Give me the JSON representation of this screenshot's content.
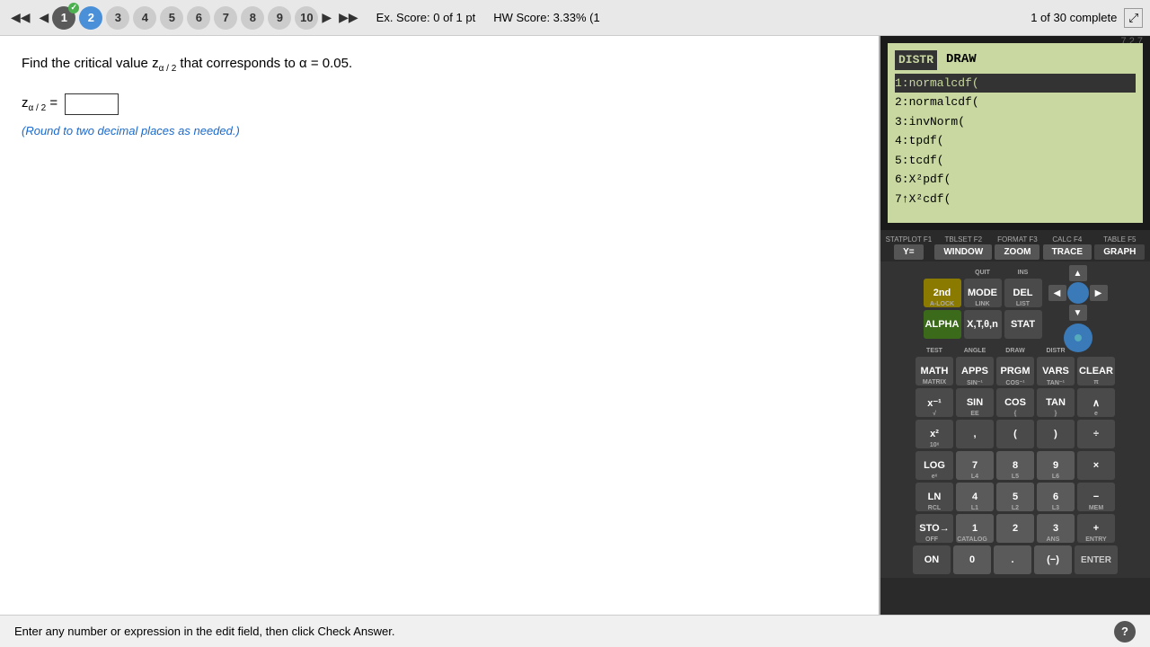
{
  "version": "7.2.7",
  "nav": {
    "prev_label": "◀◀",
    "prev_single": "◀",
    "next_single": "▶",
    "next_last": "▶▶",
    "items": [
      {
        "num": "1",
        "state": "completed"
      },
      {
        "num": "2",
        "state": "active"
      },
      {
        "num": "3",
        "state": "inactive"
      },
      {
        "num": "4",
        "state": "inactive"
      },
      {
        "num": "5",
        "state": "inactive"
      },
      {
        "num": "6",
        "state": "inactive"
      },
      {
        "num": "7",
        "state": "inactive"
      },
      {
        "num": "8",
        "state": "inactive"
      },
      {
        "num": "9",
        "state": "inactive"
      },
      {
        "num": "10",
        "state": "inactive"
      }
    ],
    "ex_score": "Ex. Score: 0 of 1 pt",
    "hw_score": "HW Score: 3.33% (1",
    "complete": "1 of 30 complete"
  },
  "question": {
    "text_part1": "Find the critical value z",
    "subscript": "α / 2",
    "text_part2": " that corresponds to α = 0.05.",
    "answer_label": "z",
    "answer_subscript": "α / 2",
    "answer_equals": " = ",
    "hint": "(Round to two decimal places as needed.)"
  },
  "calculator": {
    "screen": {
      "header_distr": "DISTR",
      "header_draw": "DRAW",
      "items": [
        {
          "num": "1",
          "text": "normalcdf(",
          "selected": true
        },
        {
          "num": "2",
          "text": "normalcdf("
        },
        {
          "num": "3",
          "text": "invNorm("
        },
        {
          "num": "4",
          "text": "tpdf("
        },
        {
          "num": "5",
          "text": "tcdf("
        },
        {
          "num": "6",
          "text": "X²pdf("
        },
        {
          "num": "7",
          "text": "↑X²cdf("
        }
      ]
    },
    "func_row": [
      {
        "top": "STATPLOT F1",
        "label": "Y="
      },
      {
        "top": "TBLSET F2",
        "label": "WINDOW"
      },
      {
        "top": "FORMAT F3",
        "label": "ZOOM"
      },
      {
        "top": "CALC F4",
        "label": "TRACE"
      },
      {
        "top": "TABLE F5",
        "label": "GRAPH"
      }
    ],
    "keys": {
      "row1": [
        {
          "label": "2nd",
          "class": "key-2nd",
          "top": ""
        },
        {
          "label": "MODE",
          "class": "key-mode",
          "top": "QUIT"
        },
        {
          "label": "DEL",
          "class": "key-del",
          "top": "INS"
        }
      ],
      "row2": [
        {
          "label": "ALPHA",
          "class": "key-alpha",
          "top": "A-LOCK"
        },
        {
          "label": "X,T,θ,n",
          "class": "key-xtoon",
          "top": "LINK"
        },
        {
          "label": "STAT",
          "class": "key-stat",
          "top": "LIST"
        }
      ],
      "row3": [
        {
          "label": "MATH",
          "class": "key-math",
          "top": "TEST"
        },
        {
          "label": "APPS",
          "class": "key-apps",
          "top": "ANGLE"
        },
        {
          "label": "PRGM",
          "class": "key-prgm",
          "top": "DRAW"
        },
        {
          "label": "VARS",
          "class": "key-vars",
          "top": "DISTR"
        },
        {
          "label": "CLEAR",
          "class": "key-clear",
          "top": ""
        }
      ],
      "row4": [
        {
          "label": "x⁻¹",
          "class": "key-xinv",
          "top": "MATRIX"
        },
        {
          "label": "SIN",
          "class": "key-sin",
          "top": "SIN⁻¹"
        },
        {
          "label": "COS",
          "class": "key-cos",
          "top": "COS⁻¹"
        },
        {
          "label": "TAN",
          "class": "key-tan",
          "top": "TAN⁻¹"
        },
        {
          "label": "∧",
          "class": "key-caret",
          "top": "π"
        }
      ],
      "row5": [
        {
          "label": "x²",
          "class": "key-x2",
          "top": "√"
        },
        {
          "label": ",",
          "class": "key-comma",
          "top": "EE"
        },
        {
          "label": "(",
          "class": "key-lparen",
          "top": "{"
        },
        {
          "label": ")",
          "class": "key-rparen",
          "top": "}"
        },
        {
          "label": "÷",
          "class": "key-div",
          "top": "e"
        }
      ],
      "row6": [
        {
          "label": "LOG",
          "class": "key-log",
          "top": "10ˣ"
        },
        {
          "label": "7",
          "class": "key-7",
          "top": ""
        },
        {
          "label": "8",
          "class": "key-8",
          "top": ""
        },
        {
          "label": "9",
          "class": "key-9",
          "top": ""
        },
        {
          "label": "×",
          "class": "key-mul",
          "top": ""
        }
      ],
      "row7": [
        {
          "label": "LN",
          "class": "key-ln",
          "top": "eˣ"
        },
        {
          "label": "4",
          "class": "key-4",
          "top": "L4"
        },
        {
          "label": "5",
          "class": "key-5",
          "top": "L5"
        },
        {
          "label": "6",
          "class": "key-6",
          "top": "L6"
        },
        {
          "label": "−",
          "class": "key-minus",
          "top": ""
        }
      ],
      "row8": [
        {
          "label": "STO→",
          "class": "key-sto",
          "top": "RCL"
        },
        {
          "label": "1",
          "class": "key-1",
          "top": "L1"
        },
        {
          "label": "2",
          "class": "key-2",
          "top": "L2"
        },
        {
          "label": "3",
          "class": "key-3",
          "top": "L3"
        },
        {
          "label": "+",
          "class": "key-plus",
          "top": "MEM"
        }
      ],
      "row9": [
        {
          "label": "ON",
          "class": "key-on",
          "top": "OFF"
        },
        {
          "label": "0",
          "class": "key-0",
          "top": "CATALOG"
        },
        {
          "label": ".",
          "class": "key-dot",
          "top": ""
        },
        {
          "label": "(−)",
          "class": "key-neg",
          "top": "ANS"
        },
        {
          "label": "ENTER",
          "class": "key-enter",
          "top": "ENTRY"
        }
      ]
    }
  },
  "status_bar": {
    "text": "Enter any number or expression in the edit field, then click Check Answer.",
    "help_label": "?"
  }
}
